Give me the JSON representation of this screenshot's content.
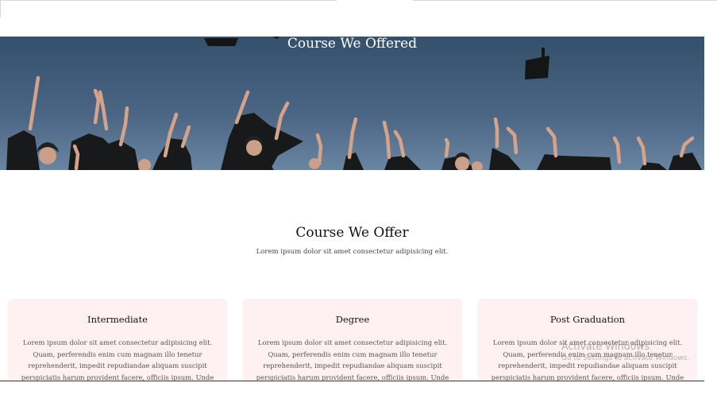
{
  "hero": {
    "title": "Course We Offered"
  },
  "section": {
    "title": "Course We Offer",
    "subtitle": "Lorem ipsum dolor sit amet consectetur adipisicing elit."
  },
  "cards": [
    {
      "title": "Intermediate",
      "text": "Lorem ipsum dolor sit amet consectetur adipisicing elit. Quam, perferendis enim cum magnam illo tenetur reprehenderit, impedit repudiandae aliquam suscipit perspiciatis harum provident facere, officiis ipsum. Unde maxime consequuntur"
    },
    {
      "title": "Degree",
      "text": "Lorem ipsum dolor sit amet consectetur adipisicing elit. Quam, perferendis enim cum magnam illo tenetur reprehenderit, impedit repudiandae aliquam suscipit perspiciatis harum provident facere, officiis ipsum. Unde maxime consequuntur"
    },
    {
      "title": "Post Graduation",
      "text": "Lorem ipsum dolor sit amet consectetur adipisicing elit. Quam, perferendis enim cum magnam illo tenetur reprehenderit, impedit repudiandae aliquam suscipit perspiciatis harum provident facere, officiis ipsum. Unde maxime consequuntur"
    }
  ],
  "watermark": {
    "title": "Activate Windows",
    "subtitle": "Go to Settings to activate Windows."
  },
  "colors": {
    "card_background": "#fff1f1",
    "hero_sky": "#4a6381",
    "gown": "#1a1c1f"
  }
}
